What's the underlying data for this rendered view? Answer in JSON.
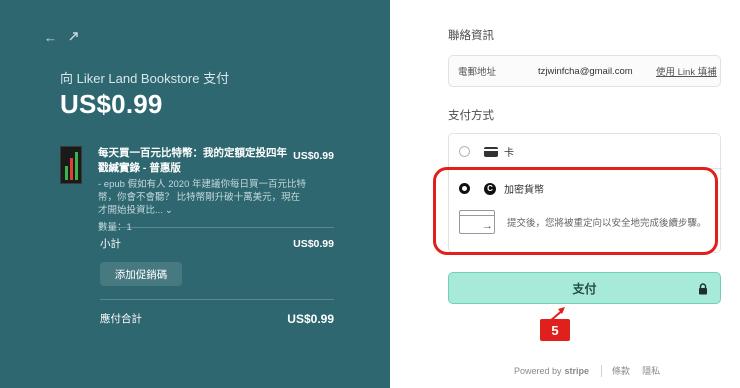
{
  "left": {
    "pay_to": "向 Liker Land Bookstore 支付",
    "amount": "US$0.99",
    "product": {
      "name": "每天買一百元比特幣：我的定額定投四年戳緘實錄 - 普惠版",
      "description": "- epub 假如有人 2020 年建議你每日買一百元比特幣，你會不會聽？ 比特幣剛升破十萬美元，現在才開始投資比...",
      "quantity": "數量：1",
      "price": "US$0.99"
    },
    "subtotal_label": "小計",
    "subtotal_value": "US$0.99",
    "promo_label": "添加促銷碼",
    "total_label": "應付合計",
    "total_value": "US$0.99"
  },
  "right": {
    "contact_title": "聯絡資訊",
    "email_label": "電郵地址",
    "email_value": "tzjwinfcha@gmail.com",
    "link_fill": "使用 Link 填補",
    "payment_title": "支付方式",
    "method_card": "卡",
    "method_crypto": "加密貨幣",
    "redirect_note": "提交後，您將被重定向以安全地完成後續步驟。",
    "pay_button": "支付",
    "step_badge": "5"
  },
  "footer": {
    "powered": "Powered by",
    "stripe": "stripe",
    "terms": "條款",
    "privacy": "隱私"
  },
  "colors": {
    "panel": "#2e6770",
    "pay_button": "#a7ead9",
    "highlight": "#e0201c"
  }
}
